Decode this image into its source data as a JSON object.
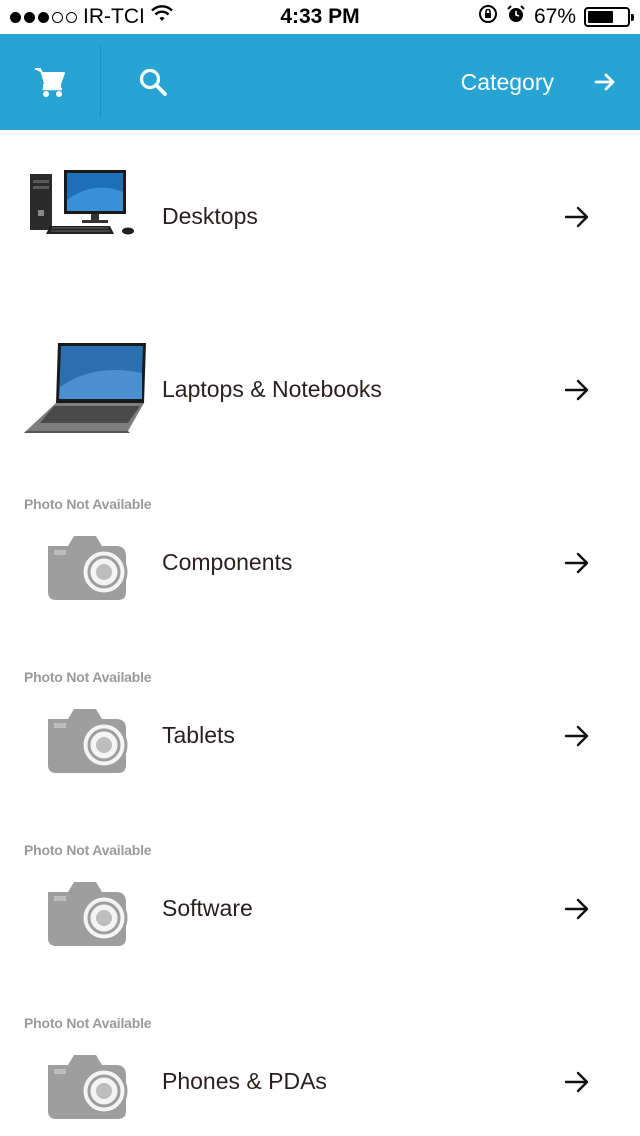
{
  "status_bar": {
    "carrier": "IR-TCI",
    "time": "4:33 PM",
    "battery_percent": "67%",
    "battery_level": 0.67,
    "signal_filled": 3,
    "signal_total": 5
  },
  "toolbar": {
    "title": "Category",
    "cart_icon": "cart-icon",
    "search_icon": "search-icon",
    "forward_icon": "arrow-right-icon",
    "background": "#27a4d3"
  },
  "categories": [
    {
      "label": "Desktops",
      "image": "desktop-computer-photo",
      "photo_available": true
    },
    {
      "label": "Laptops & Notebooks",
      "image": "laptop-photo",
      "photo_available": true
    },
    {
      "label": "Components",
      "image": "camera-placeholder-icon",
      "photo_available": false,
      "placeholder_text": "Photo Not Available"
    },
    {
      "label": "Tablets",
      "image": "camera-placeholder-icon",
      "photo_available": false,
      "placeholder_text": "Photo Not Available"
    },
    {
      "label": "Software",
      "image": "camera-placeholder-icon",
      "photo_available": false,
      "placeholder_text": "Photo Not Available"
    },
    {
      "label": "Phones & PDAs",
      "image": "camera-placeholder-icon",
      "photo_available": false,
      "placeholder_text": "Photo Not Available"
    }
  ]
}
